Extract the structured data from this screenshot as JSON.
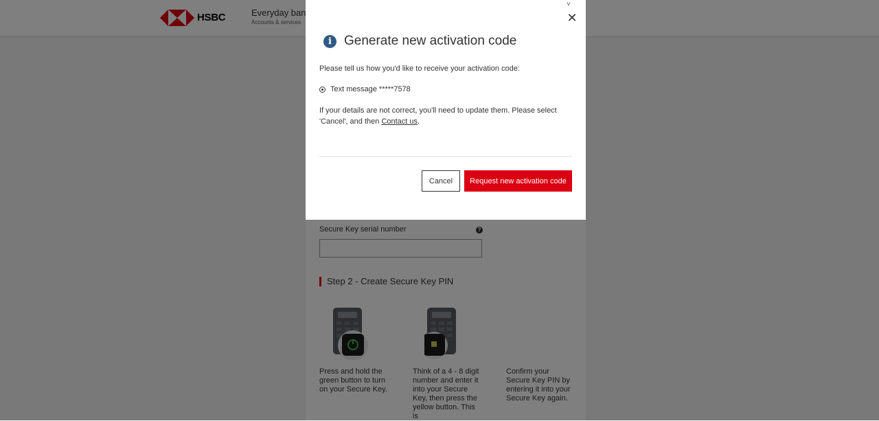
{
  "header": {
    "brand": "HSBC",
    "nav_title": "Everyday bank",
    "nav_subtitle": "Accounts & services"
  },
  "page": {
    "serial_label": "Secure Key serial number",
    "serial_value": "",
    "help_icon": "?",
    "step2_heading": "Step 2 - Create Secure Key PIN",
    "steps": [
      {
        "text": "Press and hold the green button to turn on your Secure Key.",
        "icon": "secure-key-green-button"
      },
      {
        "text": "Think of a 4 - 8 digit number and enter it into your Secure Key, then press the yellow button. This is",
        "icon": "secure-key-yellow-button"
      },
      {
        "text": "Confirm your Secure Key PIN by entering it into your Secure Key again."
      }
    ]
  },
  "modal": {
    "title": "Generate new activation code",
    "prompt": "Please tell us how you'd like to receive your activation code:",
    "option_label": "Text message *****7578",
    "note_before": "If your details are not correct, you'll need to update them. Please select 'Cancel', and then ",
    "contact_link": "Contact us",
    "note_after": ".",
    "cancel_label": "Cancel",
    "request_label": "Request new activation code",
    "close_symbol": "✕",
    "info_symbol": "i",
    "scroll_symbol": "˅"
  },
  "colors": {
    "brand_red": "#db0011",
    "info_blue": "#305a85",
    "overlay": "rgba(0,0,0,0.5)"
  }
}
